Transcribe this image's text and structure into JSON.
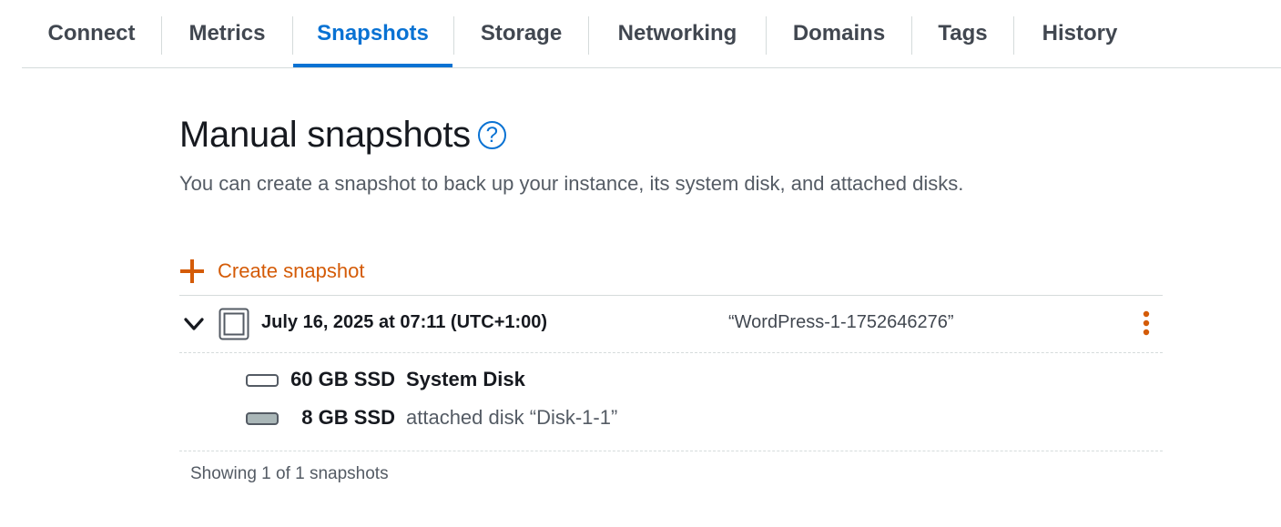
{
  "tabs": [
    {
      "label": "Connect",
      "active": false
    },
    {
      "label": "Metrics",
      "active": false
    },
    {
      "label": "Snapshots",
      "active": true
    },
    {
      "label": "Storage",
      "active": false
    },
    {
      "label": "Networking",
      "active": false
    },
    {
      "label": "Domains",
      "active": false
    },
    {
      "label": "Tags",
      "active": false
    },
    {
      "label": "History",
      "active": false
    }
  ],
  "section": {
    "title": "Manual snapshots",
    "help_icon": "?",
    "description": "You can create a snapshot to back up your instance, its system disk, and attached disks."
  },
  "create_button": {
    "label": "Create snapshot",
    "icon": "plus-icon"
  },
  "snapshots": [
    {
      "date": "July 16, 2025 at 07:11 (UTC+1:00)",
      "name": "“WordPress-1-1752646276”",
      "expanded": true,
      "disks": [
        {
          "size": "60 GB SSD",
          "label": "System Disk",
          "kind": "system"
        },
        {
          "size": "8 GB SSD",
          "label": "attached disk “Disk-1-1”",
          "kind": "attached"
        }
      ]
    }
  ],
  "footer": {
    "count_text": "Showing 1 of 1 snapshots"
  },
  "colors": {
    "accent_blue": "#0972d3",
    "accent_orange": "#d45b07",
    "text_dark": "#16191f",
    "text_muted": "#545b64",
    "divider": "#d5dbdb"
  }
}
